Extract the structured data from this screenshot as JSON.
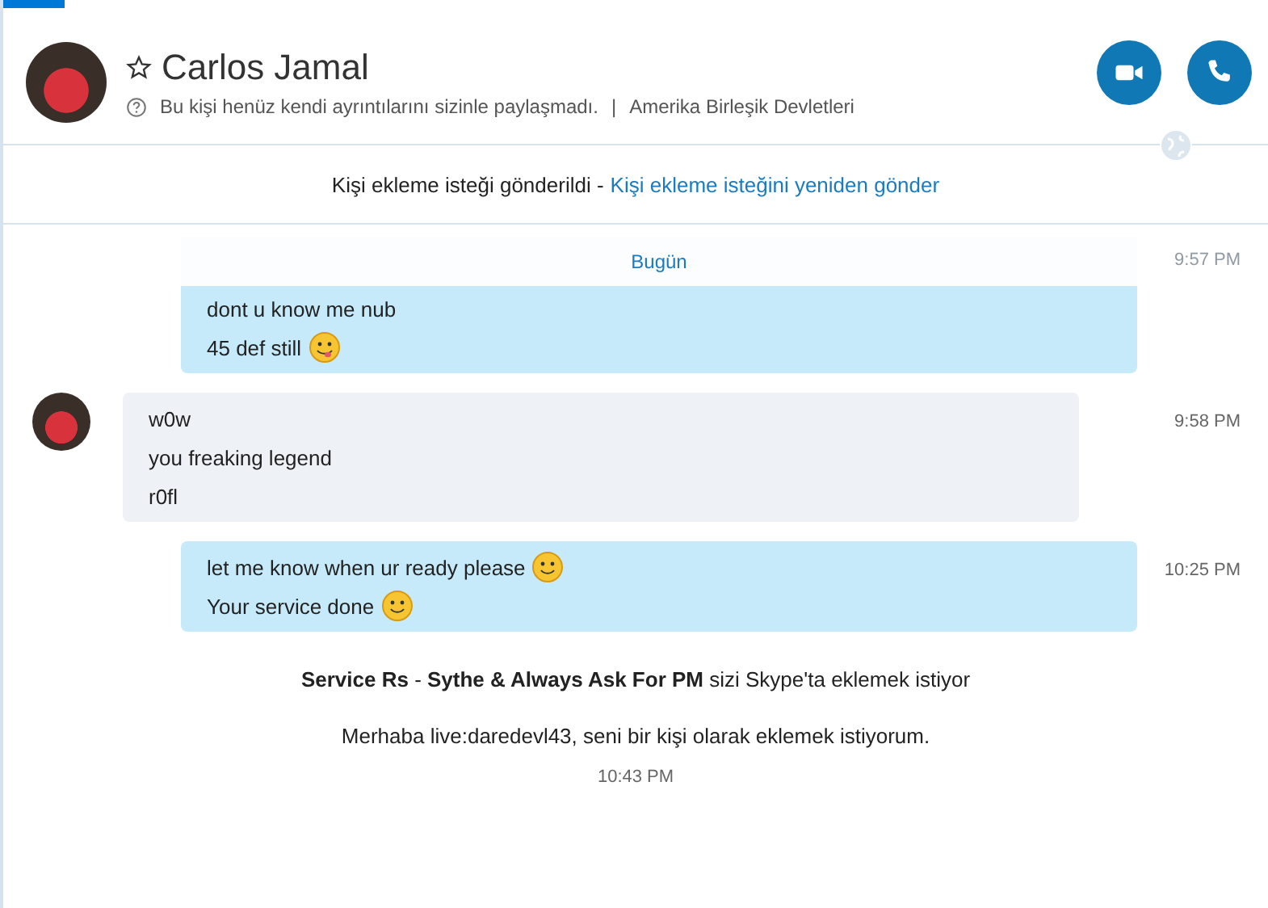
{
  "contact": {
    "name": "Carlos Jamal",
    "favorite": false,
    "note": "Bu kişi henüz kendi ayrıntılarını sizinle paylaşmadı.",
    "separator": "|",
    "location": "Amerika Birleşik Devletleri"
  },
  "request_notice": {
    "text": "Kişi ekleme isteği gönderildi -",
    "link": "Kişi ekleme isteğini yeniden gönder"
  },
  "messages": [
    {
      "kind": "outgoing",
      "date_divider": "Bugün",
      "time": "9:57 PM",
      "lines": [
        {
          "kind": "text",
          "text": "dont u know me nub"
        },
        {
          "kind": "tongue",
          "text": "45 def still"
        }
      ]
    },
    {
      "kind": "incoming",
      "time": "9:58 PM",
      "lines": [
        {
          "kind": "text",
          "text": "w0w"
        },
        {
          "kind": "text",
          "text": "you freaking legend"
        },
        {
          "kind": "text",
          "text": "r0fl"
        }
      ]
    },
    {
      "kind": "outgoing",
      "time": "10:25 PM",
      "lines": [
        {
          "kind": "smile",
          "text": "let me know when ur ready please"
        },
        {
          "kind": "smile",
          "text": "Your service done"
        }
      ]
    }
  ],
  "contact_request": {
    "title": "**Service Rs** - **Sythe & Always Ask For PM** sizi Skype'ta eklemek istiyor",
    "message": "Merhaba live:daredevl43, seni bir kişi olarak eklemek istiyorum.",
    "time": "10:43 PM"
  }
}
